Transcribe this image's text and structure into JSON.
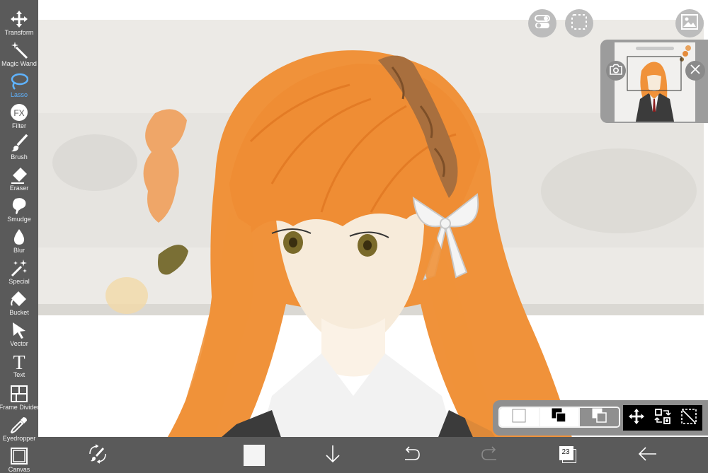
{
  "toolbar": {
    "tools": [
      {
        "label": "Transform",
        "icon": "transform-icon"
      },
      {
        "label": "Magic Wand",
        "icon": "magic-wand-icon"
      },
      {
        "label": "Lasso",
        "icon": "lasso-icon",
        "active": true
      },
      {
        "label": "Filter",
        "icon": "fx-icon"
      },
      {
        "label": "Brush",
        "icon": "brush-icon"
      },
      {
        "label": "Eraser",
        "icon": "eraser-icon"
      },
      {
        "label": "Smudge",
        "icon": "smudge-icon"
      },
      {
        "label": "Blur",
        "icon": "blur-drop-icon"
      },
      {
        "label": "Special",
        "icon": "special-wand-icon"
      },
      {
        "label": "Bucket",
        "icon": "bucket-icon"
      },
      {
        "label": "Vector",
        "icon": "vector-arrow-icon"
      },
      {
        "label": "Text",
        "icon": "text-icon"
      },
      {
        "label": "Frame Divider",
        "icon": "frame-divider-icon"
      },
      {
        "label": "Eyedropper",
        "icon": "eyedropper-icon"
      },
      {
        "label": "Canvas",
        "icon": "canvas-icon"
      }
    ],
    "active_color": "#5fb3ff"
  },
  "top_buttons": {
    "toggle": "toggle-icon",
    "selection": "dashed-selection-icon",
    "reference": "image-icon"
  },
  "reference_window": {
    "camera": "camera-icon",
    "close": "close-icon"
  },
  "mode_panel": {
    "modes": [
      "selection-mode-normal-icon",
      "selection-mode-add-icon",
      "selection-mode-subtract-icon"
    ],
    "actions": [
      "move-icon",
      "transform-layer-icon",
      "deselect-icon"
    ]
  },
  "bottom_bar": {
    "layer_count": "23",
    "current_color": "#f4f4f4",
    "icons": [
      "brush-swap-icon",
      "color-swatch",
      "down-arrow-icon",
      "undo-icon",
      "redo-icon",
      "layers-icon",
      "back-arrow-icon"
    ]
  },
  "colors": {
    "toolbar_bg": "#5a5a5a",
    "hair_orange": "#f0943a",
    "skin": "#f6ead8",
    "headband_brown": "#a86f3e",
    "eye_olive": "#7a6a2a"
  }
}
